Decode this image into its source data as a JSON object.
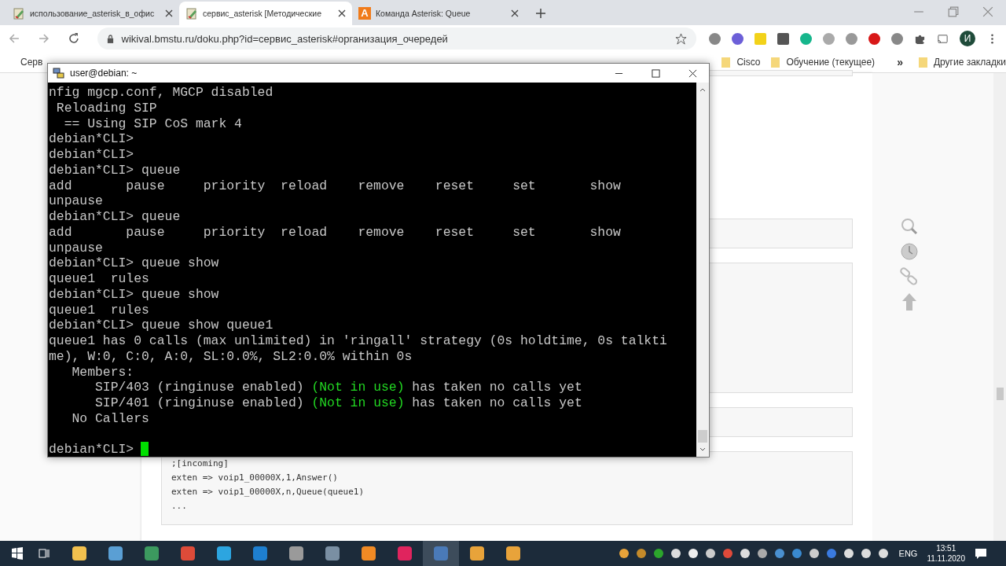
{
  "browser": {
    "tabs": [
      {
        "title": "использование_asterisk_в_офис",
        "selected": false
      },
      {
        "title": "сервис_asterisk [Методические",
        "selected": true
      },
      {
        "title": "Команда Asterisk: Queue",
        "selected": false,
        "letter": "A"
      }
    ],
    "url": "wikival.bmstu.ru/doku.php?id=сервис_asterisk#организация_очередей",
    "profile": "И",
    "bookmarks": [
      {
        "label": "Серв"
      },
      {
        "label": "Cisco"
      },
      {
        "label": "Обучение (текущее)"
      }
    ],
    "more": "»",
    "other_bookmarks": "Другие закладки"
  },
  "page": {
    "code_lines": [
      ";[incoming]",
      "exten => voip1_00000X,1,Answer()",
      "exten => voip1_00000X,n,Queue(queue1)",
      "..."
    ]
  },
  "terminal": {
    "title": "user@debian: ~",
    "prompt": "debian*CLI> ",
    "lines": [
      {
        "text": "nfig mgcp.conf, MGCP disabled"
      },
      {
        "text": " Reloading SIP"
      },
      {
        "text": "  == Using SIP CoS mark 4"
      },
      {
        "text": "debian*CLI>"
      },
      {
        "text": "debian*CLI>"
      },
      {
        "text": "debian*CLI> queue"
      },
      {
        "text": "add       pause     priority  reload    remove    reset     set       show"
      },
      {
        "text": "unpause"
      },
      {
        "text": "debian*CLI> queue"
      },
      {
        "text": "add       pause     priority  reload    remove    reset     set       show"
      },
      {
        "text": "unpause"
      },
      {
        "text": "debian*CLI> queue show"
      },
      {
        "text": "queue1  rules"
      },
      {
        "text": "debian*CLI> queue show"
      },
      {
        "text": "queue1  rules"
      },
      {
        "text": "debian*CLI> queue show queue1"
      },
      {
        "text": "queue1 has 0 calls (max unlimited) in 'ringall' strategy (0s holdtime, 0s talkti"
      },
      {
        "text": "me), W:0, C:0, A:0, SL:0.0%, SL2:0.0% within 0s"
      },
      {
        "text": "   Members:"
      },
      {
        "parts": [
          {
            "text": "      SIP/403 (ringinuse enabled) ",
            "color": "#c8c8c8"
          },
          {
            "text": "(Not in use)",
            "color": "#22d822"
          },
          {
            "text": " has taken no calls yet",
            "color": "#c8c8c8"
          }
        ]
      },
      {
        "parts": [
          {
            "text": "      SIP/401 (ringinuse enabled) ",
            "color": "#c8c8c8"
          },
          {
            "text": "(Not in use)",
            "color": "#22d822"
          },
          {
            "text": " has taken no calls yet",
            "color": "#c8c8c8"
          }
        ]
      },
      {
        "text": "   No Callers"
      },
      {
        "kind": "blank"
      }
    ]
  },
  "taskbar": {
    "language": "ENG",
    "time": "13:51",
    "date": "11.11.2020"
  }
}
